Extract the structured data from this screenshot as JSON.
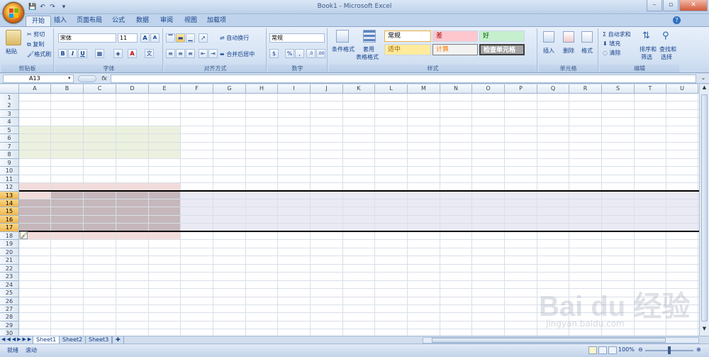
{
  "window": {
    "title": "Book1 - Microsoft Excel",
    "minimize": "–",
    "restore": "▫",
    "close": "✕"
  },
  "qat": {
    "save": "💾",
    "undo": "↶",
    "redo": "↷",
    "more": "▾"
  },
  "tabs": [
    "开始",
    "插入",
    "页面布局",
    "公式",
    "数据",
    "审阅",
    "视图",
    "加载项"
  ],
  "ribbon": {
    "clipboard": {
      "label": "剪贴板",
      "paste": "粘贴",
      "cut": "剪切",
      "copy": "复制",
      "format_painter": "格式刷"
    },
    "font": {
      "label": "字体",
      "name": "宋体",
      "size": "11",
      "grow": "A",
      "shrink": "A",
      "bold": "B",
      "italic": "I",
      "underline": "U"
    },
    "alignment": {
      "label": "对齐方式",
      "wrap": "自动换行",
      "merge": "合并后居中"
    },
    "number": {
      "label": "数字",
      "format": "常规",
      "percent": "%",
      "comma": ","
    },
    "styles": {
      "label": "样式",
      "conditional": "条件格式",
      "table_line1": "套用",
      "table_line2": "表格格式",
      "normal": "常规",
      "bad": "差",
      "good": "好",
      "neutral": "适中",
      "calc": "计算",
      "check": "检查单元格"
    },
    "cells": {
      "label": "单元格",
      "insert": "插入",
      "delete": "删除",
      "format": "格式"
    },
    "editing": {
      "label": "编辑",
      "autosum": "自动求和",
      "fill": "填充",
      "clear": "清除",
      "sort_line1": "排序和",
      "sort_line2": "筛选",
      "find_line1": "查找和",
      "find_line2": "选择"
    }
  },
  "formula_bar": {
    "name_box": "A13",
    "fx": "fx",
    "value": ""
  },
  "columns": [
    "A",
    "B",
    "C",
    "D",
    "E",
    "F",
    "G",
    "H",
    "I",
    "J",
    "K",
    "L",
    "M",
    "N",
    "O",
    "P",
    "Q",
    "R",
    "S",
    "T",
    "U"
  ],
  "rows": [
    "1",
    "2",
    "3",
    "4",
    "5",
    "6",
    "7",
    "8",
    "9",
    "10",
    "11",
    "12",
    "13",
    "14",
    "15",
    "16",
    "17",
    "18",
    "19",
    "20",
    "21",
    "22",
    "23",
    "24",
    "25",
    "26",
    "27",
    "28",
    "29",
    "30"
  ],
  "selected_rows": [
    "13",
    "14",
    "15",
    "16",
    "17"
  ],
  "fills": {
    "green": "#ebf1de",
    "pink": "#f2dcdb",
    "selection": "#eaeaf4",
    "selected_fill": "#c5b7bb"
  },
  "sheets": [
    "Sheet1",
    "Sheet2",
    "Sheet3"
  ],
  "status": {
    "ready": "就绪",
    "mode": "滚动",
    "zoom": "100%"
  },
  "watermark": {
    "brand": "Bai du 经验",
    "url": "jingyan.baidu.com"
  }
}
